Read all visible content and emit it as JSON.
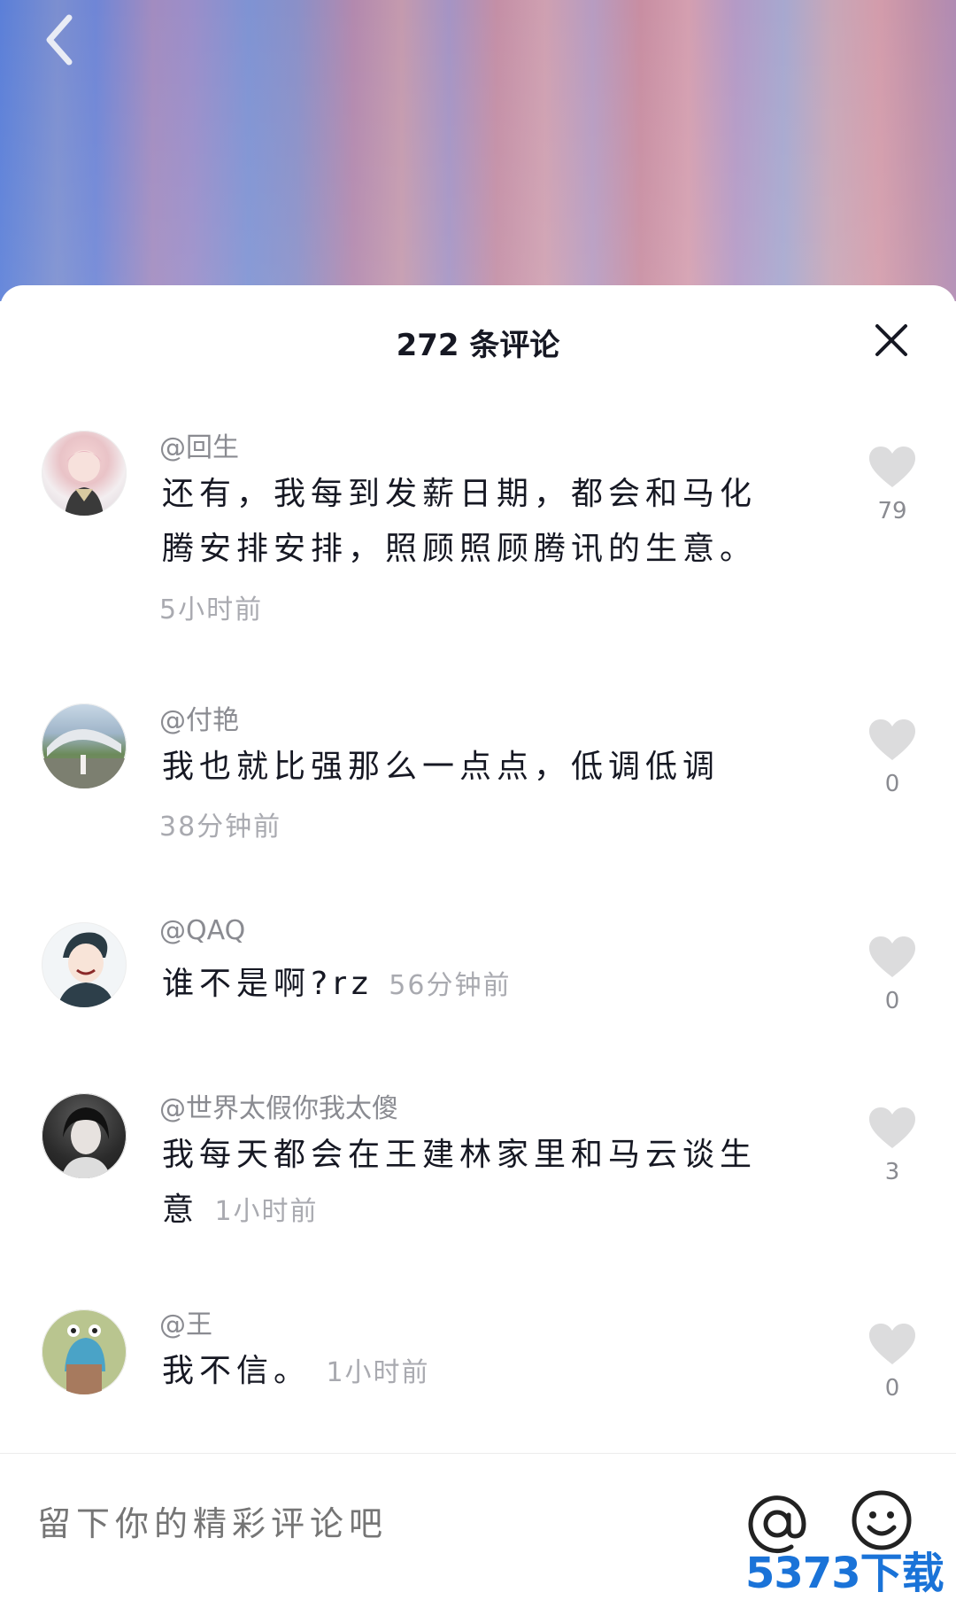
{
  "sheet": {
    "title": "272 条评论"
  },
  "comments": [
    {
      "author": "@回生",
      "text": "还有，我每到发薪日期，都会和马化腾安排安排，照顾照顾腾讯的生意。",
      "time": "5小时前",
      "likes": "79"
    },
    {
      "author": "@付艳",
      "text": "我也就比强那么一点点，低调低调",
      "time": "38分钟前",
      "likes": "0"
    },
    {
      "author": "@QAQ",
      "text": "谁不是啊?rz",
      "time": "56分钟前",
      "likes": "0"
    },
    {
      "author": "@世界太假你我太傻",
      "text": "我每天都会在王建林家里和马云谈生意",
      "time": "1小时前",
      "likes": "3"
    },
    {
      "author": "@王",
      "text": "我不信。",
      "time": "1小时前",
      "likes": "0"
    }
  ],
  "input": {
    "placeholder": "留下你的精彩评论吧"
  },
  "watermark": "5373下载",
  "icons": {
    "back": "chevron-left-icon",
    "close": "close-icon",
    "like": "heart-icon",
    "mention": "at-icon",
    "emoji": "emoji-icon"
  },
  "colors": {
    "text_primary": "#161823",
    "text_secondary": "#8a8b91",
    "heart": "#dcdcdd",
    "watermark": "#1a73d8"
  }
}
